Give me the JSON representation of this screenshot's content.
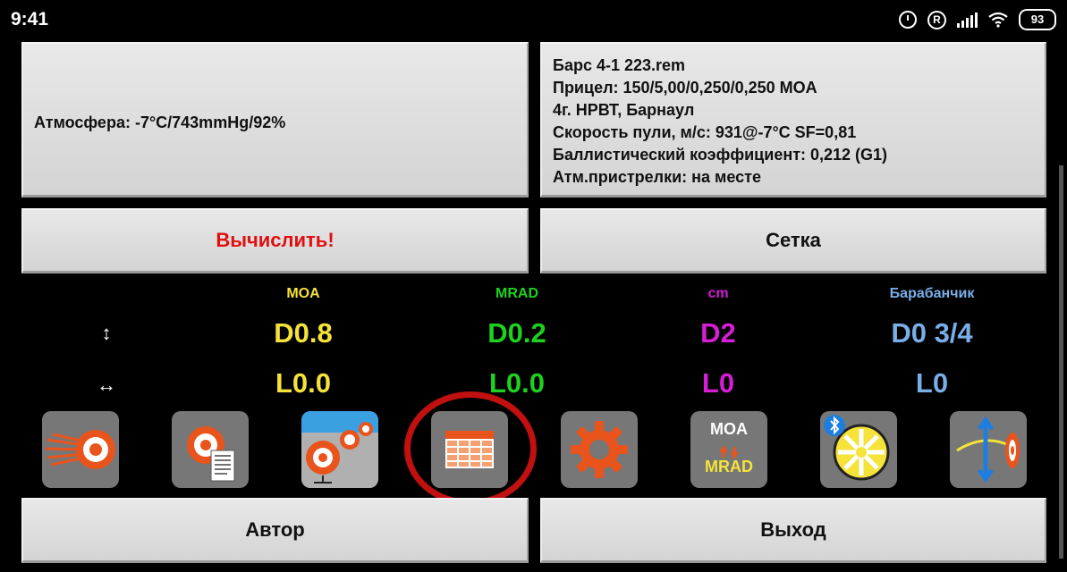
{
  "status_bar": {
    "time": "9:41",
    "battery": "93"
  },
  "atmosphere": {
    "text": "Атмосфера: -7°C/743mmHg/92%"
  },
  "profile_info": {
    "lines": [
      "Барс 4-1 223.rem",
      "Прицел: 150/5,00/0,250/0,250 MOA",
      "4г. НРВТ, Барнаул",
      "Скорость пули, м/с: 931@-7°C SF=0,81",
      "Баллистический коэффициент: 0,212 (G1)",
      "Атм.пристрелки: на месте"
    ]
  },
  "buttons": {
    "calculate": "Вычислить!",
    "reticle": "Сетка",
    "author": "Автор",
    "exit": "Выход"
  },
  "units": {
    "moa": {
      "label": "MOA",
      "vertical": "D0.8",
      "horizontal": "L0.0",
      "color": "#f6e33a"
    },
    "mrad": {
      "label": "MRAD",
      "vertical": "D0.2",
      "horizontal": "L0.0",
      "color": "#1fd11f"
    },
    "cm": {
      "label": "cm",
      "vertical": "D2",
      "horizontal": "L0",
      "color": "#d61ed6"
    },
    "turret": {
      "label": "Барабанчик",
      "vertical": "D0 3/4",
      "horizontal": "L0",
      "color": "#7aaee8"
    }
  },
  "row_icons": {
    "vertical": "↕",
    "horizontal": "↔"
  },
  "toolbar": {
    "unit_toggle_top": "MOA",
    "unit_toggle_bottom": "MRAD"
  },
  "colors": {
    "accent_orange": "#e8541c",
    "highlight_ring": "#c01010",
    "tool_bg": "#777777"
  }
}
